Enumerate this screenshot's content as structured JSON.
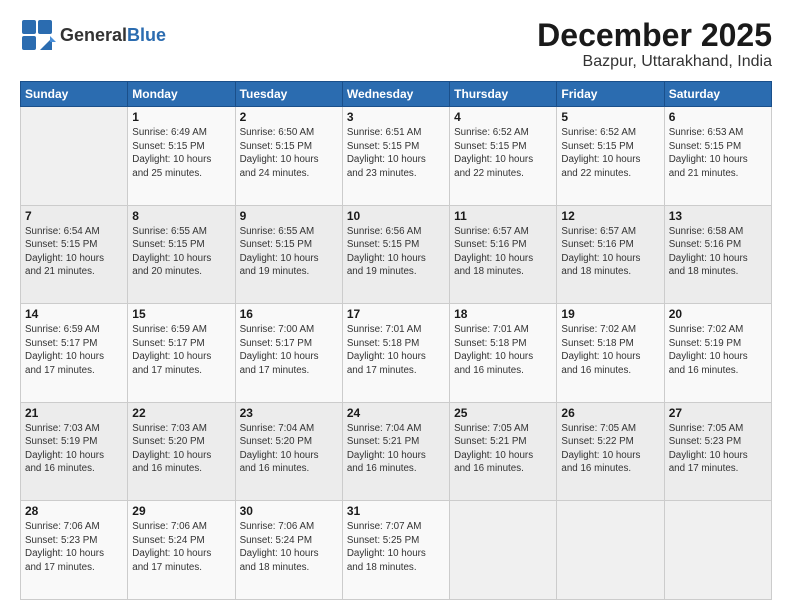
{
  "logo": {
    "general": "General",
    "blue": "Blue"
  },
  "title": "December 2025",
  "subtitle": "Bazpur, Uttarakhand, India",
  "days_header": [
    "Sunday",
    "Monday",
    "Tuesday",
    "Wednesday",
    "Thursday",
    "Friday",
    "Saturday"
  ],
  "weeks": [
    [
      {
        "num": "",
        "info": ""
      },
      {
        "num": "1",
        "info": "Sunrise: 6:49 AM\nSunset: 5:15 PM\nDaylight: 10 hours\nand 25 minutes."
      },
      {
        "num": "2",
        "info": "Sunrise: 6:50 AM\nSunset: 5:15 PM\nDaylight: 10 hours\nand 24 minutes."
      },
      {
        "num": "3",
        "info": "Sunrise: 6:51 AM\nSunset: 5:15 PM\nDaylight: 10 hours\nand 23 minutes."
      },
      {
        "num": "4",
        "info": "Sunrise: 6:52 AM\nSunset: 5:15 PM\nDaylight: 10 hours\nand 22 minutes."
      },
      {
        "num": "5",
        "info": "Sunrise: 6:52 AM\nSunset: 5:15 PM\nDaylight: 10 hours\nand 22 minutes."
      },
      {
        "num": "6",
        "info": "Sunrise: 6:53 AM\nSunset: 5:15 PM\nDaylight: 10 hours\nand 21 minutes."
      }
    ],
    [
      {
        "num": "7",
        "info": "Sunrise: 6:54 AM\nSunset: 5:15 PM\nDaylight: 10 hours\nand 21 minutes."
      },
      {
        "num": "8",
        "info": "Sunrise: 6:55 AM\nSunset: 5:15 PM\nDaylight: 10 hours\nand 20 minutes."
      },
      {
        "num": "9",
        "info": "Sunrise: 6:55 AM\nSunset: 5:15 PM\nDaylight: 10 hours\nand 19 minutes."
      },
      {
        "num": "10",
        "info": "Sunrise: 6:56 AM\nSunset: 5:15 PM\nDaylight: 10 hours\nand 19 minutes."
      },
      {
        "num": "11",
        "info": "Sunrise: 6:57 AM\nSunset: 5:16 PM\nDaylight: 10 hours\nand 18 minutes."
      },
      {
        "num": "12",
        "info": "Sunrise: 6:57 AM\nSunset: 5:16 PM\nDaylight: 10 hours\nand 18 minutes."
      },
      {
        "num": "13",
        "info": "Sunrise: 6:58 AM\nSunset: 5:16 PM\nDaylight: 10 hours\nand 18 minutes."
      }
    ],
    [
      {
        "num": "14",
        "info": "Sunrise: 6:59 AM\nSunset: 5:17 PM\nDaylight: 10 hours\nand 17 minutes."
      },
      {
        "num": "15",
        "info": "Sunrise: 6:59 AM\nSunset: 5:17 PM\nDaylight: 10 hours\nand 17 minutes."
      },
      {
        "num": "16",
        "info": "Sunrise: 7:00 AM\nSunset: 5:17 PM\nDaylight: 10 hours\nand 17 minutes."
      },
      {
        "num": "17",
        "info": "Sunrise: 7:01 AM\nSunset: 5:18 PM\nDaylight: 10 hours\nand 17 minutes."
      },
      {
        "num": "18",
        "info": "Sunrise: 7:01 AM\nSunset: 5:18 PM\nDaylight: 10 hours\nand 16 minutes."
      },
      {
        "num": "19",
        "info": "Sunrise: 7:02 AM\nSunset: 5:18 PM\nDaylight: 10 hours\nand 16 minutes."
      },
      {
        "num": "20",
        "info": "Sunrise: 7:02 AM\nSunset: 5:19 PM\nDaylight: 10 hours\nand 16 minutes."
      }
    ],
    [
      {
        "num": "21",
        "info": "Sunrise: 7:03 AM\nSunset: 5:19 PM\nDaylight: 10 hours\nand 16 minutes."
      },
      {
        "num": "22",
        "info": "Sunrise: 7:03 AM\nSunset: 5:20 PM\nDaylight: 10 hours\nand 16 minutes."
      },
      {
        "num": "23",
        "info": "Sunrise: 7:04 AM\nSunset: 5:20 PM\nDaylight: 10 hours\nand 16 minutes."
      },
      {
        "num": "24",
        "info": "Sunrise: 7:04 AM\nSunset: 5:21 PM\nDaylight: 10 hours\nand 16 minutes."
      },
      {
        "num": "25",
        "info": "Sunrise: 7:05 AM\nSunset: 5:21 PM\nDaylight: 10 hours\nand 16 minutes."
      },
      {
        "num": "26",
        "info": "Sunrise: 7:05 AM\nSunset: 5:22 PM\nDaylight: 10 hours\nand 16 minutes."
      },
      {
        "num": "27",
        "info": "Sunrise: 7:05 AM\nSunset: 5:23 PM\nDaylight: 10 hours\nand 17 minutes."
      }
    ],
    [
      {
        "num": "28",
        "info": "Sunrise: 7:06 AM\nSunset: 5:23 PM\nDaylight: 10 hours\nand 17 minutes."
      },
      {
        "num": "29",
        "info": "Sunrise: 7:06 AM\nSunset: 5:24 PM\nDaylight: 10 hours\nand 17 minutes."
      },
      {
        "num": "30",
        "info": "Sunrise: 7:06 AM\nSunset: 5:24 PM\nDaylight: 10 hours\nand 18 minutes."
      },
      {
        "num": "31",
        "info": "Sunrise: 7:07 AM\nSunset: 5:25 PM\nDaylight: 10 hours\nand 18 minutes."
      },
      {
        "num": "",
        "info": ""
      },
      {
        "num": "",
        "info": ""
      },
      {
        "num": "",
        "info": ""
      }
    ]
  ]
}
